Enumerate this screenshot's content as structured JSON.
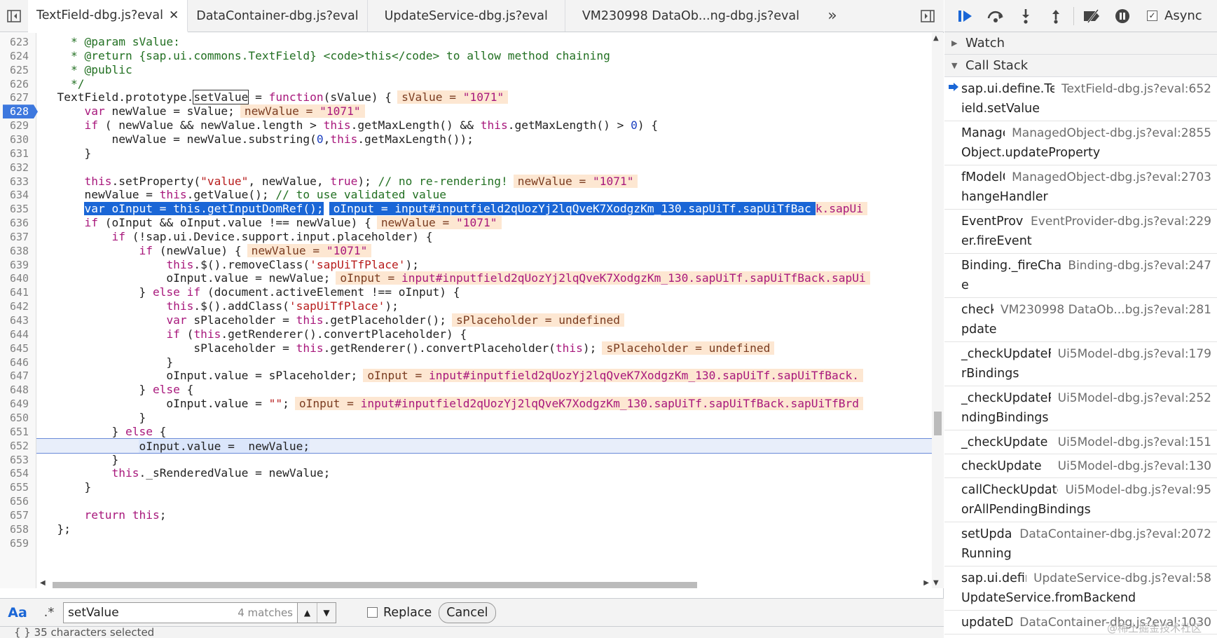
{
  "tabs": [
    {
      "label": "TextField-dbg.js?eval",
      "active": true
    },
    {
      "label": "DataContainer-dbg.js?eval",
      "active": false
    },
    {
      "label": "UpdateService-dbg.js?eval",
      "active": false
    },
    {
      "label": "VM230998 DataOb...ng-dbg.js?eval",
      "active": false
    }
  ],
  "code": {
    "first_line": 623,
    "paused_line": 652,
    "breakpoint_line": 628,
    "last_partial_line": "659"
  },
  "search": {
    "query": "setValue",
    "match_count": "4 matches",
    "replace_label": "Replace",
    "cancel_label": "Cancel",
    "case_label": "Aa",
    "regex_label": ".*"
  },
  "status": {
    "text": "{ }   35 characters selected"
  },
  "debugger": {
    "async_label": "Async",
    "watch_label": "Watch",
    "callstack_label": "Call Stack",
    "frames": [
      {
        "name": "sap.ui.define.TextF",
        "name2": "ield.setValue",
        "location": "TextField-dbg.js?eval:652",
        "current": true
      },
      {
        "name": "Managed",
        "name2": "Object.updateProperty",
        "location": "ManagedObject-dbg.js?eval:2855"
      },
      {
        "name": "fModelC",
        "name2": "hangeHandler",
        "location": "ManagedObject-dbg.js?eval:2703"
      },
      {
        "name": "EventProvid",
        "name2": "er.fireEvent",
        "location": "EventProvider-dbg.js?eval:229"
      },
      {
        "name": "Binding._fireChang",
        "name2": "e",
        "location": "Binding-dbg.js?eval:247"
      },
      {
        "name": "checkU",
        "name2": "pdate",
        "location": "VM230998 DataOb...bg.js?eval:281"
      },
      {
        "name": "_checkUpdateFo",
        "name2": "rBindings",
        "location": "Ui5Model-dbg.js?eval:179"
      },
      {
        "name": "_checkUpdatePe",
        "name2": "ndingBindings",
        "location": "Ui5Model-dbg.js?eval:252"
      },
      {
        "name": "_checkUpdate",
        "name2": "",
        "location": "Ui5Model-dbg.js?eval:151"
      },
      {
        "name": "checkUpdate",
        "name2": "",
        "location": "Ui5Model-dbg.js?eval:130"
      },
      {
        "name": "callCheckUpdateF",
        "name2": "orAllPendingBindings",
        "location": "Ui5Model-dbg.js?eval:95"
      },
      {
        "name": "setUpdate",
        "name2": "Running",
        "location": "DataContainer-dbg.js?eval:2072"
      },
      {
        "name": "sap.ui.define.",
        "name2": "UpdateService.fromBackend",
        "location": "UpdateService-dbg.js?eval:58"
      },
      {
        "name": "updateDat",
        "name2": "",
        "location": "DataContainer-dbg.js?eval:1030"
      }
    ]
  },
  "watermark": "@稀土掘金技术社区",
  "colors": {
    "breakpoint": "#3d78de",
    "selection": "#1a66d6",
    "inline_value_bg": "#fde7d2",
    "keyword": "#a8187c",
    "comment": "#227022",
    "string": "#b71c1c"
  }
}
